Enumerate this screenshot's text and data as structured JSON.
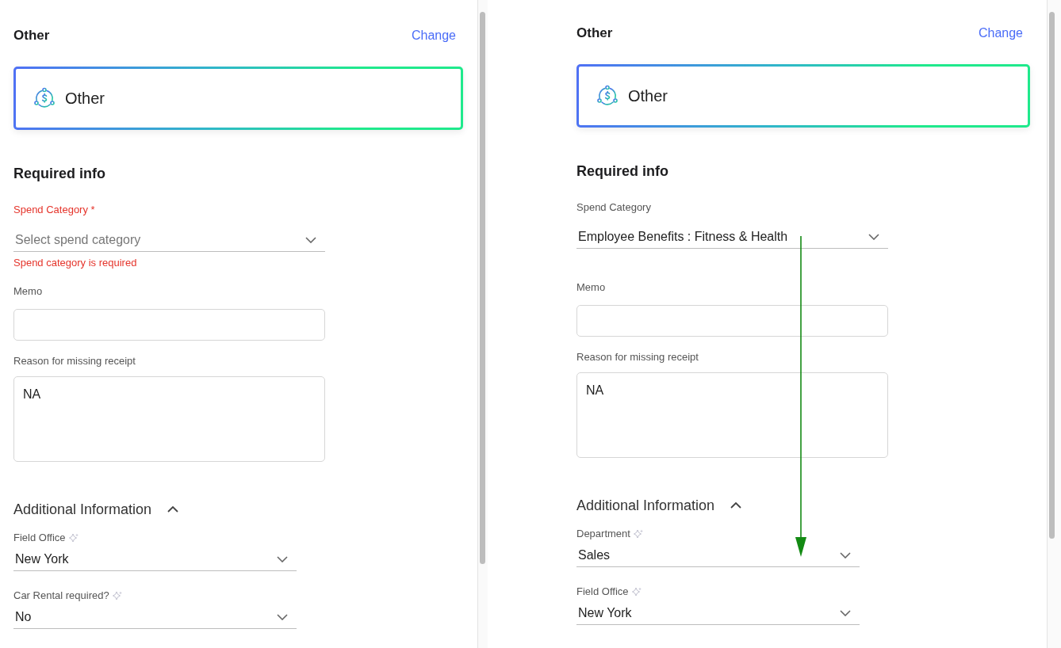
{
  "panels": [
    {
      "header": {
        "title": "Other",
        "action": "Change"
      },
      "category": {
        "label": "Other"
      },
      "required_info": {
        "heading": "Required info",
        "fields": [
          {
            "kind": "select",
            "label": "Spend Category",
            "error": true,
            "required_mark": "*",
            "placeholder": "Select spend category",
            "message": "Spend category is required"
          },
          {
            "kind": "text",
            "label": "Memo",
            "error": false
          },
          {
            "kind": "textarea",
            "label": "Reason for missing receipt",
            "error": false,
            "value": "NA"
          }
        ]
      },
      "additional_info": {
        "heading": "Additional Information",
        "expanded": true,
        "fields": [
          {
            "label": "Field Office",
            "ai_suggested": true,
            "value": "New York"
          },
          {
            "label": "Car Rental required?",
            "ai_suggested": true,
            "value": "No"
          }
        ]
      }
    },
    {
      "header": {
        "title": "Other",
        "action": "Change"
      },
      "category": {
        "label": "Other"
      },
      "required_info": {
        "heading": "Required info",
        "fields": [
          {
            "kind": "select",
            "label": "Spend Category",
            "error": false,
            "value": "Employee Benefits : Fitness & Health"
          },
          {
            "kind": "text",
            "label": "Memo",
            "error": false
          },
          {
            "kind": "textarea",
            "label": "Reason for missing receipt",
            "error": false,
            "value": "NA"
          }
        ]
      },
      "additional_info": {
        "heading": "Additional Information",
        "expanded": true,
        "fields": [
          {
            "label": "Department",
            "ai_suggested": true,
            "value": "Sales"
          },
          {
            "label": "Field Office",
            "ai_suggested": true,
            "value": "New York"
          }
        ]
      }
    }
  ]
}
